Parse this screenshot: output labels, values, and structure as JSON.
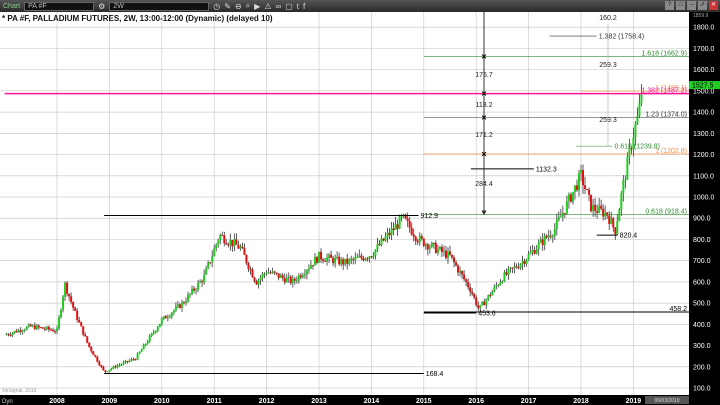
{
  "toolbar": {
    "app_label": "Chart",
    "symbol": "PA #F",
    "interval": "2W",
    "icons": [
      "clock-icon",
      "pencil-icon",
      "minus-circle-icon",
      "zoom-icon",
      "play-icon",
      "settings-icon",
      "link-icon",
      "comment-icon",
      "twitter-icon",
      "facebook-icon"
    ]
  },
  "title": "* PA #F, PALLADIUM FUTURES, 2W, 13:00-12:00 (Dynamic) (delayed 10)",
  "credit": "©eSignal, 2019",
  "date_box": "06/03/2019",
  "dyn_label": "Dyn",
  "top_value": "1859.9",
  "chart_data": {
    "type": "candlestick",
    "ylim": [
      80,
      1860
    ],
    "yticks": [
      "100.0",
      "200.0",
      "300.0",
      "400.0",
      "500.0",
      "600.0",
      "700.0",
      "800.0",
      "900.0",
      "1000.0",
      "1100.0",
      "1200.0",
      "1300.0",
      "1400.0",
      "1500.0",
      "1600.0",
      "1700.0",
      "1800.0"
    ],
    "xticks": [
      "2008",
      "2009",
      "2010",
      "2011",
      "2012",
      "2013",
      "2014",
      "2015",
      "2016",
      "2017",
      "2018",
      "2019"
    ],
    "xlim": [
      2007.0,
      2019.5
    ],
    "last_price": "1527.5",
    "price_path": [
      [
        2007.0,
        350
      ],
      [
        2007.5,
        390
      ],
      [
        2008.0,
        370
      ],
      [
        2008.15,
        590
      ],
      [
        2008.35,
        450
      ],
      [
        2008.6,
        300
      ],
      [
        2008.9,
        175
      ],
      [
        2009.1,
        200
      ],
      [
        2009.5,
        240
      ],
      [
        2010.0,
        420
      ],
      [
        2010.4,
        500
      ],
      [
        2010.8,
        620
      ],
      [
        2011.1,
        820
      ],
      [
        2011.5,
        760
      ],
      [
        2011.8,
        600
      ],
      [
        2012.0,
        650
      ],
      [
        2012.5,
        600
      ],
      [
        2013.0,
        720
      ],
      [
        2013.5,
        690
      ],
      [
        2014.0,
        730
      ],
      [
        2014.6,
        900
      ],
      [
        2014.9,
        800
      ],
      [
        2015.5,
        720
      ],
      [
        2015.9,
        560
      ],
      [
        2016.05,
        470
      ],
      [
        2016.5,
        620
      ],
      [
        2016.9,
        700
      ],
      [
        2017.5,
        850
      ],
      [
        2018.0,
        1100
      ],
      [
        2018.2,
        950
      ],
      [
        2018.5,
        920
      ],
      [
        2018.65,
        840
      ],
      [
        2018.8,
        1050
      ],
      [
        2019.0,
        1300
      ],
      [
        2019.1,
        1390
      ],
      [
        2019.17,
        1527
      ]
    ],
    "hlines": [
      {
        "label": "1 (1499.1)",
        "value": 1499.1,
        "color": "#ff8c3a",
        "from": 2018.0
      },
      {
        "label": "1.382 (1487.2)",
        "value": 1487.2,
        "color": "#ff1493",
        "from": 2007.0,
        "bold": true
      },
      {
        "label": "1.618 (1662.9)",
        "value": 1662.9,
        "color": "#2e8b2e",
        "from": 2015.0
      },
      {
        "label": "1.23 (1374.0)",
        "value": 1374.0,
        "color": "#333333",
        "from": 2015.0
      },
      {
        "label": "1 (1202.8)",
        "value": 1202.8,
        "color": "#ff8c3a",
        "from": 2015.0
      },
      {
        "label": "0.618 (918.4)",
        "value": 918.4,
        "color": "#2e8b2e",
        "from": 2015.0
      },
      {
        "label": "1.382 (1758.4)",
        "value": 1758.4,
        "color": "#333333",
        "from": 2017.4,
        "to": 2018.3
      },
      {
        "label": "0.618 (1239.8)",
        "value": 1239.8,
        "color": "#2e8b2e",
        "from": 2017.9,
        "to": 2018.6
      },
      {
        "label": "912.9",
        "value": 912.9,
        "color": "#000000",
        "from": 2008.9,
        "to": 2014.9
      },
      {
        "label": "168.4",
        "value": 168.4,
        "color": "#000000",
        "from": 2008.9,
        "to": 2015.0
      },
      {
        "label": "458.2",
        "value": 458.2,
        "color": "#000000",
        "from": 2015.0
      },
      {
        "label": "453.6",
        "value": 453.6,
        "color": "#000000",
        "from": 2015.0,
        "to": 2016.0
      },
      {
        "label": "820.4",
        "value": 820.4,
        "color": "#000000",
        "from": 2018.3,
        "to": 2018.7
      },
      {
        "label": "1132.3",
        "value": 1132.3,
        "color": "#000000",
        "from": 2015.9,
        "to": 2017.1
      }
    ],
    "measure_labels": [
      "160.2",
      "259.3",
      "259.3",
      "175.7",
      "113.2",
      "171.2",
      "284.4"
    ]
  }
}
